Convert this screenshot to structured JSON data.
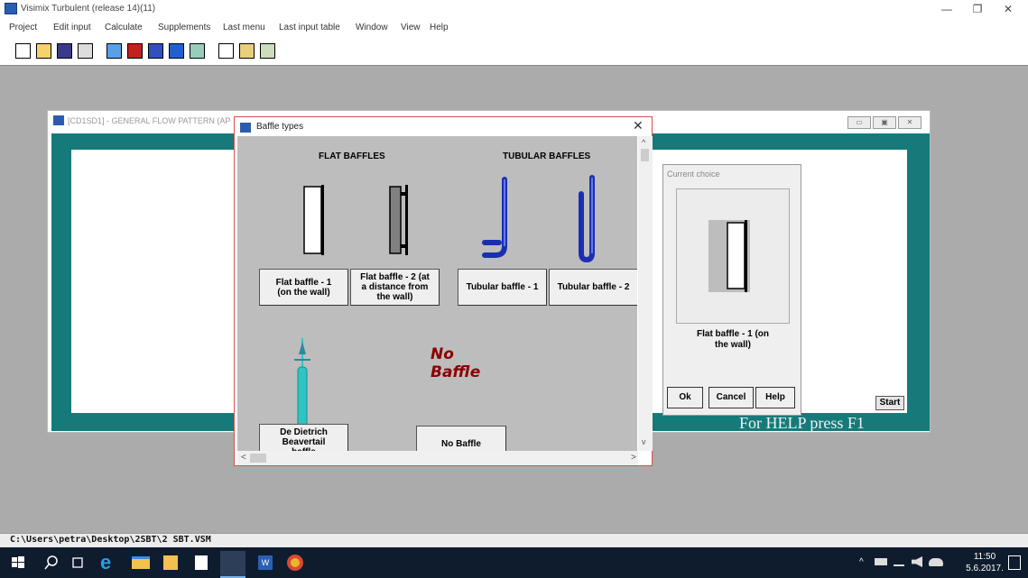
{
  "app": {
    "title": "Visimix Turbulent (release 14)(11)",
    "window_controls": {
      "minimize": "—",
      "restore": "❐",
      "close": "✕"
    }
  },
  "menu": [
    "Project",
    "Edit input",
    "Calculate",
    "Supplements",
    "Last menu",
    "Last input table",
    "Window",
    "View",
    "Help"
  ],
  "mdi": {
    "title": "[CD1SD1] - GENERAL FLOW PATTERN (AP",
    "help_text": "For HELP press F1",
    "start_label": "Start"
  },
  "dialog": {
    "title": "Baffle types",
    "close": "✕",
    "flat_header": "FLAT BAFFLES",
    "tubular_header": "TUBULAR BAFFLES",
    "buttons": {
      "flat1": "Flat baffle - 1 (on the wall)",
      "flat2": "Flat baffle - 2 (at a distance from the wall)",
      "tubular1": "Tubular baffle - 1",
      "tubular2": "Tubular baffle - 2",
      "dedietrich": "De Dietrich Beavertail baffle",
      "none": "No Baffle"
    },
    "no_baffle_art": [
      "No",
      "Baffle"
    ],
    "scroll_up": "^",
    "scroll_down": "v",
    "scroll_left": "<",
    "scroll_right": ">"
  },
  "choice": {
    "title": "Current choice",
    "label": "Flat baffle - 1 (on the wall)",
    "ok": "Ok",
    "cancel": "Cancel",
    "help": "Help"
  },
  "status": {
    "path": "C:\\Users\\petra\\Desktop\\2SBT\\2 SBT.VSM"
  },
  "taskbar": {
    "time": "11:50",
    "date": "5.6.2017."
  },
  "colors": {
    "teal": "#167a7a",
    "dialog_bg": "#bdbdbd",
    "no_baffle": "#8b0000",
    "tubular": "#1a2fb0",
    "dedietrich": "#2ec4c4"
  }
}
